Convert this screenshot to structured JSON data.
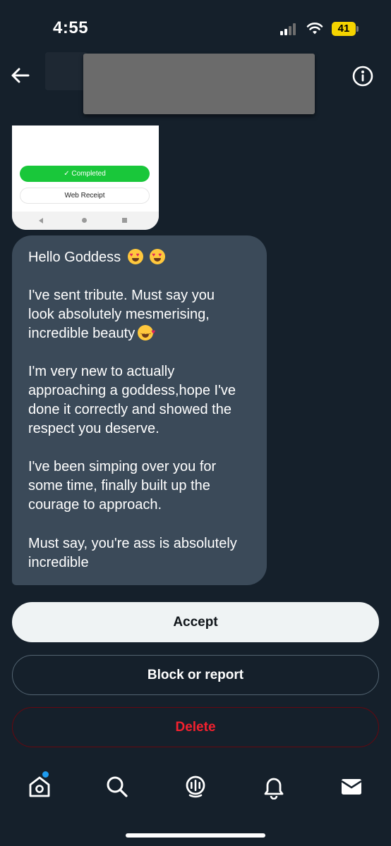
{
  "status_bar": {
    "time": "4:55",
    "battery": "41"
  },
  "colors": {
    "background": "#15202b",
    "bubble": "#3b4a59",
    "accent": "#1d9bf0",
    "delete": "#f4212e",
    "completed_green": "#19c73a"
  },
  "header": {
    "back_icon": "arrow-left-icon",
    "info_icon": "info-icon"
  },
  "attachment": {
    "completed_label": "✓ Completed",
    "receipt_label": "Web Receipt"
  },
  "message": {
    "lines_1": [
      "Hello Goddess"
    ],
    "lines_2": [
      "I've sent tribute. Must say you",
      "look absolutely mesmerising,",
      "incredible beauty"
    ],
    "lines_3": [
      "I'm very new to actually",
      "approaching a goddess,hope I've",
      "done it correctly and showed the",
      "respect you deserve."
    ],
    "lines_4": [
      "I've been simping over you for",
      "some time, finally built up the",
      "courage to approach."
    ],
    "lines_5": [
      "Must say, you're ass is absolutely",
      "incredible"
    ]
  },
  "actions": {
    "accept": "Accept",
    "block": "Block or report",
    "delete": "Delete"
  },
  "tabs": [
    "home-icon",
    "search-icon",
    "spaces-icon",
    "bell-icon",
    "mail-icon"
  ]
}
